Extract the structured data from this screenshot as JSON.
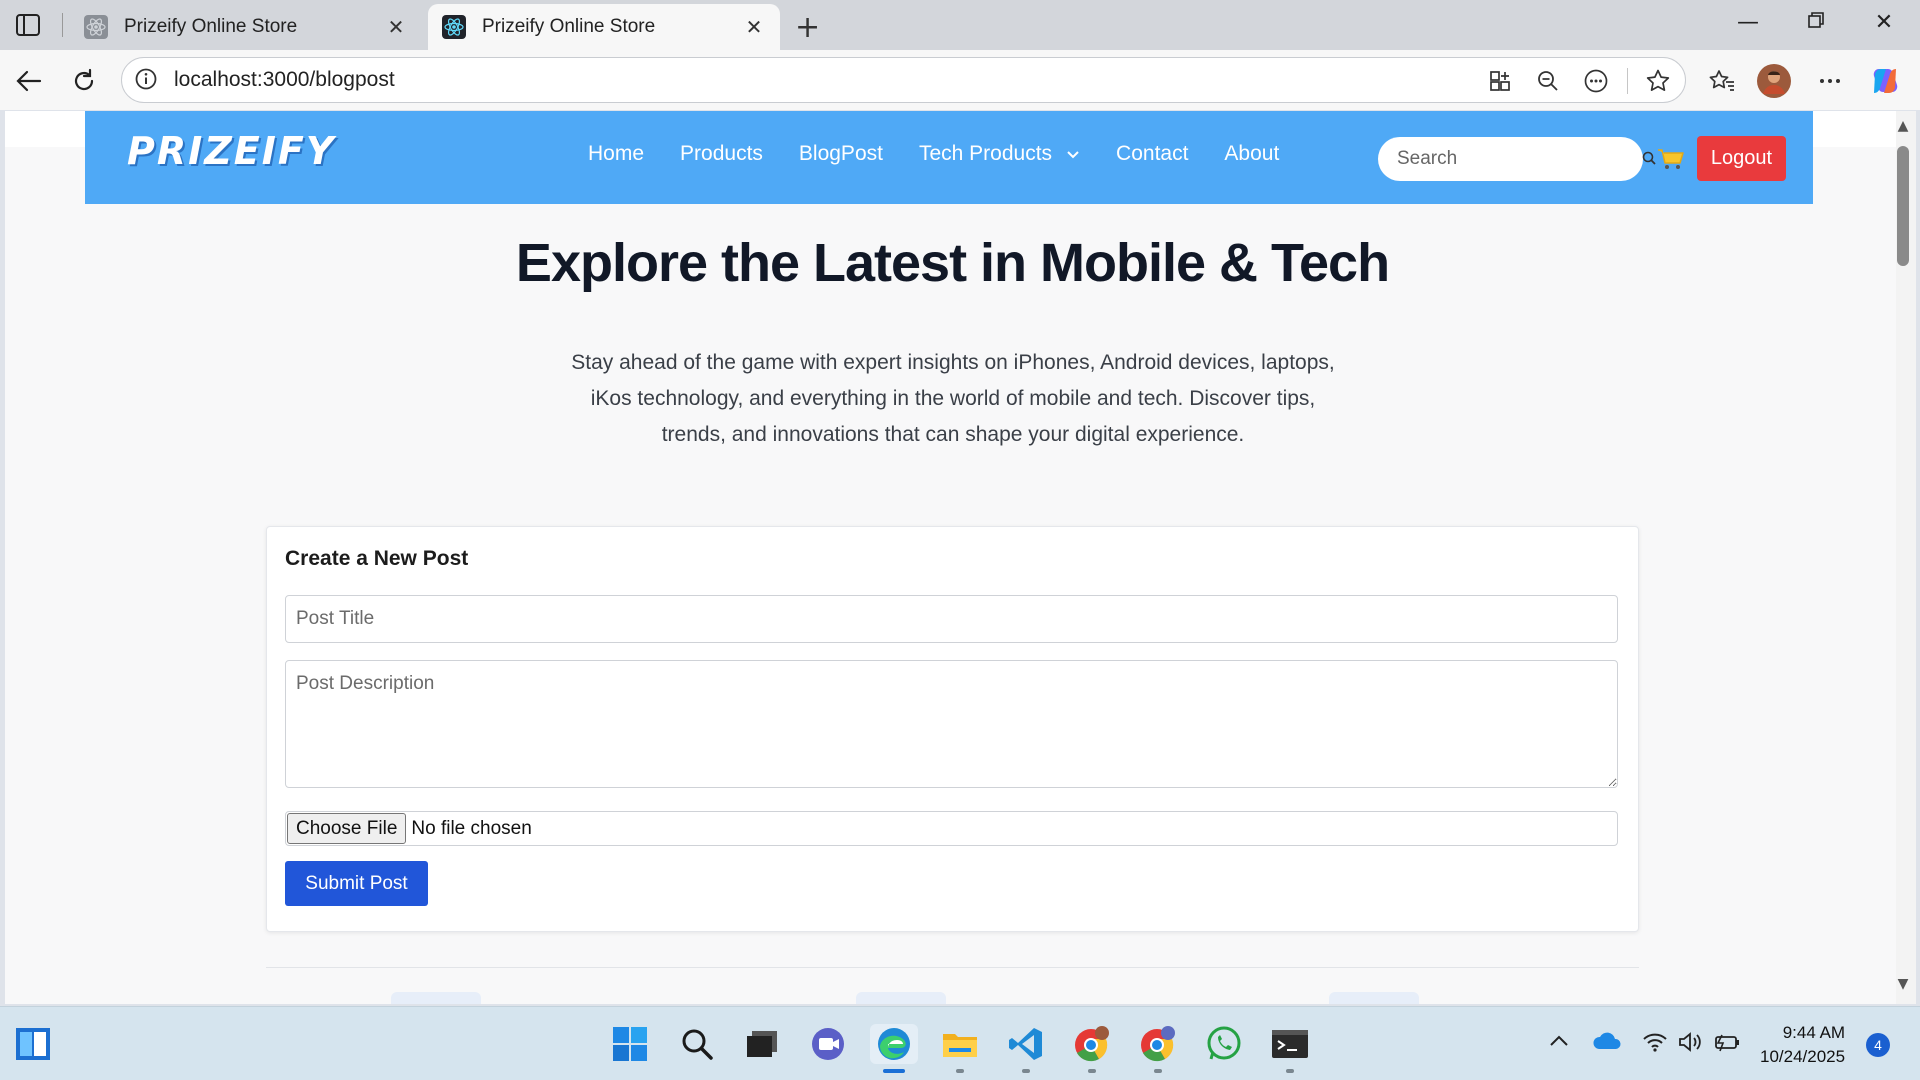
{
  "browser": {
    "tabs": [
      {
        "title": "Prizeify Online Store",
        "active": false
      },
      {
        "title": "Prizeify Online Store",
        "active": true
      }
    ],
    "url": "localhost:3000/blogpost"
  },
  "site": {
    "logo": "PRIZEIFY",
    "nav": {
      "home": "Home",
      "products": "Products",
      "blogpost": "BlogPost",
      "tech_products": "Tech Products",
      "contact": "Contact",
      "about": "About"
    },
    "search_placeholder": "Search",
    "logout_label": "Logout",
    "header_color": "#4fa9f6",
    "logout_color": "#e93a3d"
  },
  "hero": {
    "title": "Explore the Latest in Mobile & Tech",
    "subtitle": "Stay ahead of the game with expert insights on iPhones, Android devices, laptops, iKos technology, and everything in the world of mobile and tech. Discover tips, trends, and innovations that can shape your digital experience."
  },
  "form": {
    "heading": "Create a New Post",
    "title_placeholder": "Post Title",
    "description_placeholder": "Post Description",
    "choose_file_label": "Choose File",
    "no_file_text": "No file chosen",
    "submit_label": "Submit Post",
    "submit_color": "#2156d9"
  },
  "taskbar": {
    "apps": [
      "start-icon",
      "search-icon",
      "task-view-icon",
      "teams-icon",
      "edge-icon",
      "file-explorer-icon",
      "vscode-icon",
      "chrome-icon",
      "chrome-profile-icon",
      "whatsapp-icon",
      "terminal-icon"
    ],
    "time": "9:44 AM",
    "date": "10/24/2025",
    "notification_count": "4"
  }
}
